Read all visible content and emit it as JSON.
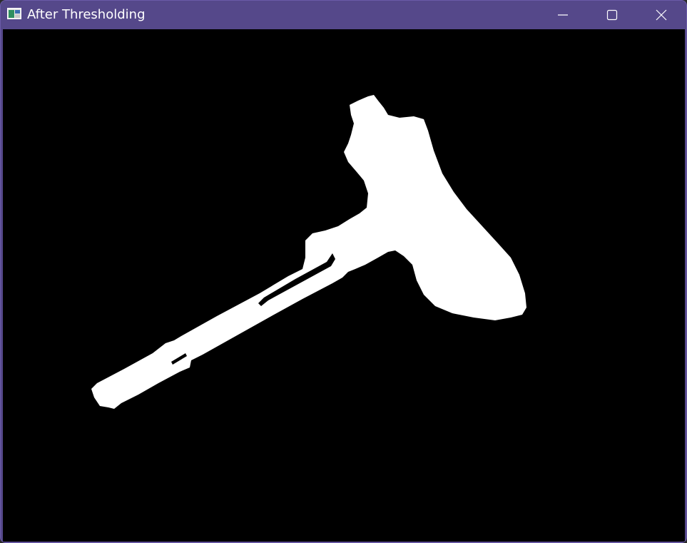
{
  "window": {
    "title": "After Thresholding",
    "app_icon": "opencv-window-icon",
    "titlebar_color": "#55488a",
    "controls": [
      {
        "name": "minimize-icon"
      },
      {
        "name": "maximize-icon"
      },
      {
        "name": "close-icon"
      }
    ]
  },
  "image": {
    "description_colors": {
      "background": "#000000",
      "foreground": "#ffffff"
    }
  }
}
